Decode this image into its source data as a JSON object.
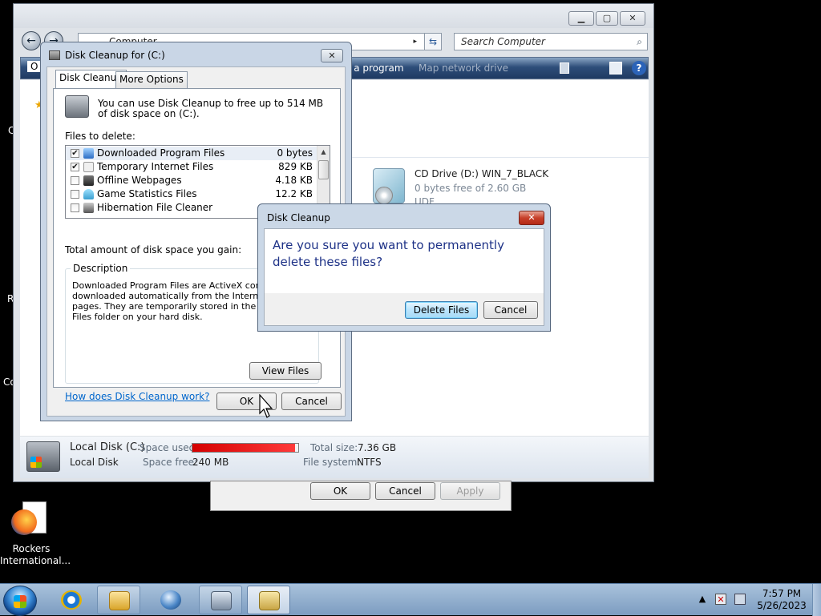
{
  "explorer": {
    "address": "Computer",
    "search_placeholder": "Search Computer",
    "toolbar": {
      "left_fragment": "O",
      "program_fragment": "e a program",
      "map_fragment": "Map network drive"
    },
    "cd_drive": {
      "title": "CD Drive (D:) WIN_7_BLACK",
      "free": "0 bytes free of 2.60 GB",
      "filesystem": "UDF"
    },
    "status": {
      "name": "Local Disk (C:)",
      "type": "Local Disk",
      "space_used_label": "Space used:",
      "space_free_label": "Space free:",
      "space_free_value": "240 MB",
      "total_size_label": "Total size:",
      "total_size_value": "7.36 GB",
      "filesystem_label": "File system:",
      "filesystem_value": "NTFS",
      "used_fraction": 0.97
    }
  },
  "properties_buttons": {
    "ok": "OK",
    "cancel": "Cancel",
    "apply": "Apply"
  },
  "cleanup": {
    "title": "Disk Cleanup for  (C:)",
    "tabs": [
      "Disk Cleanup",
      "More Options"
    ],
    "intro": "You can use Disk Cleanup to free up to 514 MB of disk space on  (C:).",
    "files_label": "Files to delete:",
    "files": [
      {
        "name": "Downloaded Program Files",
        "size": "0 bytes",
        "checked": true
      },
      {
        "name": "Temporary Internet Files",
        "size": "829 KB",
        "checked": true
      },
      {
        "name": "Offline Webpages",
        "size": "4.18 KB",
        "checked": false
      },
      {
        "name": "Game Statistics Files",
        "size": "12.2 KB",
        "checked": false
      },
      {
        "name": "Hibernation File Cleaner",
        "size": "",
        "checked": false
      }
    ],
    "total_label": "Total amount of disk space you gain:",
    "description_label": "Description",
    "description": "Downloaded Program Files are ActiveX controls a downloaded automatically from the Internet when pages. They are temporarily stored in the Downloa Files folder on your hard disk.",
    "view_files": "View Files",
    "help_link": "How does Disk Cleanup work?",
    "ok": "OK",
    "cancel": "Cancel"
  },
  "confirm": {
    "title": "Disk Cleanup",
    "message": "Are you sure you want to permanently delete these files?",
    "delete": "Delete Files",
    "cancel": "Cancel",
    "close": "✕"
  },
  "desktop": {
    "icon_label": "Rockers International...",
    "frag_c": "C",
    "frag_r": "R",
    "frag_co": "Co"
  },
  "taskbar": {
    "time": "7:57 PM",
    "date": "5/26/2023"
  },
  "colors": {
    "accent": "#1e3287",
    "used_bar": "#d40000",
    "taskbar": "#8eabcf"
  }
}
